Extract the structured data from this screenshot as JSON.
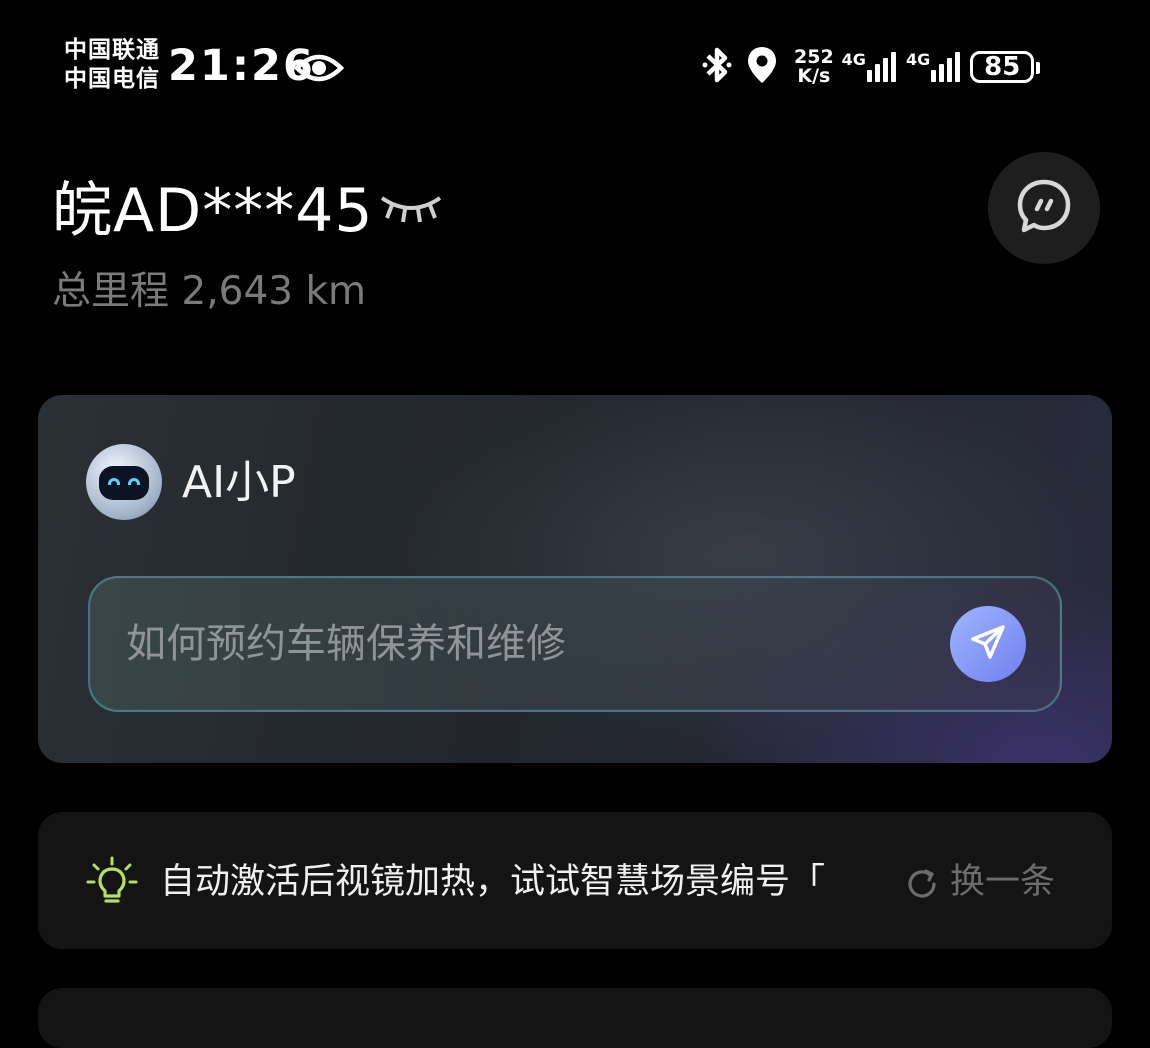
{
  "status_bar": {
    "carrier_1": "中国联通",
    "carrier_2": "中国电信",
    "time": "21:26",
    "net_speed_value": "252",
    "net_speed_unit": "K/s",
    "sim1_type": "4G",
    "sim2_type": "4G",
    "battery": "85"
  },
  "vehicle": {
    "plate": "皖AD***45",
    "mileage_label": "总里程",
    "mileage_value": "2,643 km"
  },
  "assistant": {
    "name": "AI小P",
    "input_placeholder": "如何预约车辆保养和维修"
  },
  "tip": {
    "text": "自动激活后视镜加热，试试智慧场景编号「",
    "refresh_label": "换一条"
  },
  "colors": {
    "background": "#000000",
    "card": "#141414",
    "accent": "#7f92f7",
    "muted_text": "#7a7a7a",
    "bulb": "#b5e05a"
  },
  "icons": {
    "status": [
      "eye-icon",
      "bluetooth-icon",
      "location-icon",
      "signal-icon",
      "battery-icon"
    ],
    "header": [
      "eye-closed-icon",
      "chat-bubble-icon"
    ],
    "assistant": [
      "robot-avatar-icon",
      "send-icon"
    ],
    "tip": [
      "lightbulb-icon",
      "refresh-icon"
    ]
  }
}
